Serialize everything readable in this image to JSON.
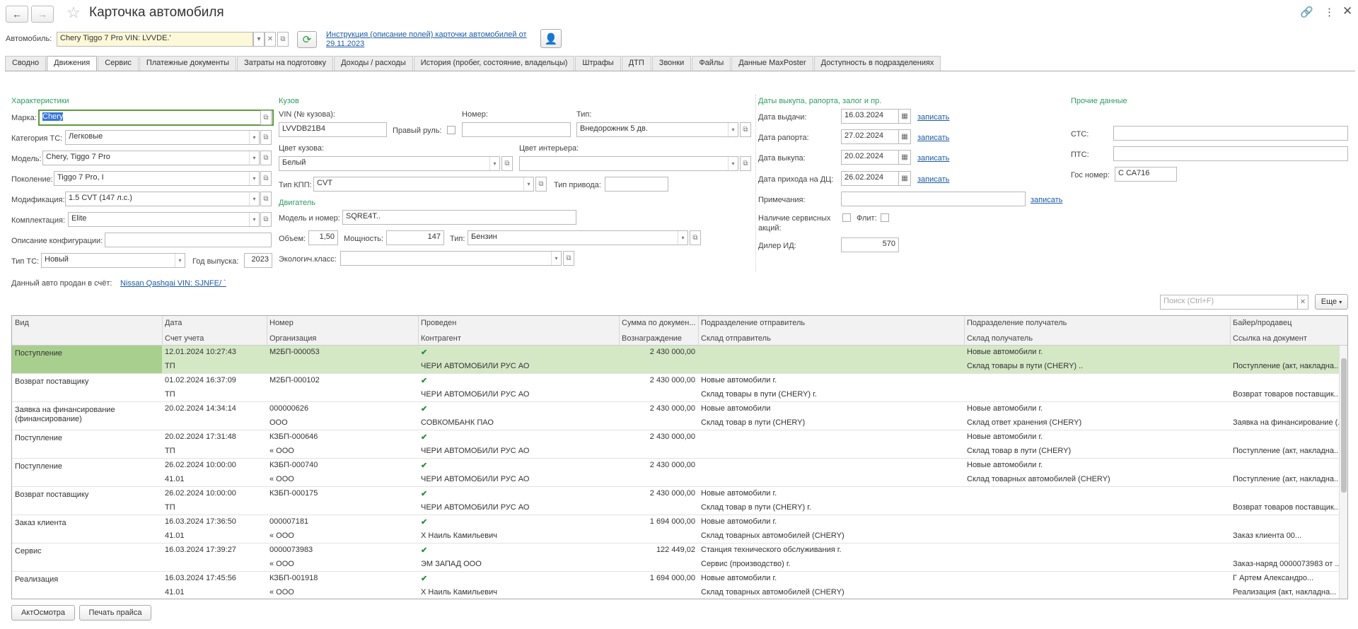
{
  "window": {
    "title": "Карточка автомобиля"
  },
  "header": {
    "car_label": "Автомобиль:",
    "car_value": "Chery Tiggo 7 Pro VIN: LVVDE.'",
    "instruction_link_line1": "Инструкция (описание полей) карточки автомобилей от",
    "instruction_link_line2": "29.11.2023"
  },
  "tabs": [
    "Сводно",
    "Движения",
    "Сервис",
    "Платежные документы",
    "Затраты на подготовку",
    "Доходы / расходы",
    "История (пробег, состояние, владельцы)",
    "Штрафы",
    "ДТП",
    "Звонки",
    "Файлы",
    "Данные MaxPoster",
    "Доступность в подразделениях"
  ],
  "characteristics": {
    "section": "Характеристики",
    "brand_label": "Марка:",
    "brand": "Chery",
    "category_label": "Категория ТС:",
    "category": "Легковые",
    "model_label": "Модель:",
    "model": "Chery, Tiggo 7 Pro",
    "generation_label": "Поколение:",
    "generation": "Tiggo 7 Pro, I",
    "modification_label": "Модификация:",
    "modification": "1.5 CVT (147 л.с.)",
    "equipment_label": "Комплектация:",
    "equipment": "Elite",
    "config_desc_label": "Описание конфигурации:",
    "config_desc": "",
    "vehicle_type_label": "Тип ТС:",
    "vehicle_type": "Новый",
    "year_label": "Год выпуска:",
    "year": "2023",
    "sold_label": "Данный авто продан в счёт:",
    "sold_link": "Nissan Qashqai VIN: SJNFE/ `"
  },
  "body": {
    "section": "Кузов",
    "vin_label": "VIN (№ кузова):",
    "vin": "LVVDB21B4",
    "right_wheel_label": "Правый руль:",
    "number_label": "Номер:",
    "number": "",
    "type_label": "Тип:",
    "type": "Внедорожник 5 дв.",
    "body_color_label": "Цвет кузова:",
    "body_color": "Белый",
    "interior_color_label": "Цвет интерьера:",
    "interior_color": "",
    "gearbox_label": "Тип КПП:",
    "gearbox": "CVT",
    "drive_label": "Тип привода:",
    "drive": ""
  },
  "engine": {
    "section": "Двигатель",
    "model_label": "Модель и номер:",
    "model": "SQRE4T..",
    "volume_label": "Объем:",
    "volume": "1,50",
    "power_label": "Мощность:",
    "power": "147",
    "type_label": "Тип:",
    "type": "Бензин",
    "eco_label": "Экологич.класс:",
    "eco": ""
  },
  "dates": {
    "section": "Даты выкупа, рапорта, залог и пр.",
    "issue_label": "Дата выдачи:",
    "issue": "16.03.2024",
    "report_label": "Дата рапорта:",
    "report": "27.02.2024",
    "buyout_label": "Дата выкупа:",
    "buyout": "20.02.2024",
    "arrival_label": "Дата прихода на ДЦ:",
    "arrival": "26.02.2024",
    "write_link": "записать",
    "notes_label": "Примечания:",
    "notes": "",
    "service_actions_label_1": "Наличие сервисных",
    "service_actions_label_2": "акций:",
    "fleet_label": "Флит:",
    "dealer_label": "Дилер ИД:",
    "dealer": "570"
  },
  "other": {
    "section": "Прочие данные",
    "sts_label": "СТС:",
    "sts": "",
    "pts_label": "ПТС:",
    "pts": "",
    "gos_label": "Гос номер:",
    "gos": "С    СА716"
  },
  "search": {
    "placeholder": "Поиск (Ctrl+F)",
    "more": "Еще"
  },
  "grid": {
    "headers_top": [
      "Вид",
      "Дата",
      "Номер",
      "Проведен",
      "Сумма по докумен...",
      "Подразделение отправитель",
      "Подразделение получатель",
      "Байер/продавец"
    ],
    "headers_bottom": [
      "Счет учета",
      "Организация",
      "Контрагент",
      "Вознаграждение",
      "Склад отправитель",
      "Склад получатель",
      "Ссылка на документ"
    ],
    "rows": [
      {
        "kind": "Поступление",
        "date": "12.01.2024 10:27:43",
        "account": "ТП",
        "number": "М2БП-000053",
        "org": "",
        "posted": "✔",
        "contractor": "ЧЕРИ АВТОМОБИЛИ РУС АО",
        "sum": "2 430 000,00",
        "reward": "",
        "sender": "",
        "sender_wh": "",
        "recipient": "Новые автомобили г.",
        "recipient_wh": "Склад товары в пути (CHERY) ..",
        "buyer": "",
        "doc": "Поступление (акт, накладна..."
      },
      {
        "kind": "Возврат поставщику",
        "date": "01.02.2024 16:37:09",
        "account": "ТП",
        "number": "М2БП-000102",
        "org": "",
        "posted": "✔",
        "contractor": "ЧЕРИ АВТОМОБИЛИ РУС АО",
        "sum": "2 430 000,00",
        "reward": "",
        "sender": "Новые автомобили г.",
        "sender_wh": "Склад товары в пути (CHERY) г.",
        "recipient": "",
        "recipient_wh": "",
        "buyer": "",
        "doc": "Возврат товаров поставщик..."
      },
      {
        "kind": "Заявка на финансирование (финансирование)",
        "date": "20.02.2024 14:34:14",
        "account": "",
        "number": "000000626",
        "org": "ООО",
        "posted": "✔",
        "contractor": "СОВКОМБАНК ПАО",
        "sum": "2 430 000,00",
        "reward": "",
        "sender": "Новые автомобили",
        "sender_wh": "Склад товар в пути (CHERY)",
        "recipient": "Новые автомобили г.",
        "recipient_wh": "Склад ответ хранения (CHERY)",
        "buyer": "",
        "doc": "Заявка на финансирование (..."
      },
      {
        "kind": "Поступление",
        "date": "20.02.2024 17:31:48",
        "account": "ТП",
        "number": "КЗБП-000646",
        "org": "« ООО",
        "posted": "✔",
        "contractor": "ЧЕРИ АВТОМОБИЛИ РУС АО",
        "sum": "2 430 000,00",
        "reward": "",
        "sender": "",
        "sender_wh": "",
        "recipient": "Новые автомобили г.",
        "recipient_wh": "Склад товар в пути (CHERY)",
        "buyer": "",
        "doc": "Поступление (акт, накладна..."
      },
      {
        "kind": "Поступление",
        "date": "26.02.2024 10:00:00",
        "account": "41.01",
        "number": "КЗБП-000740",
        "org": "« ООО",
        "posted": "✔",
        "contractor": "ЧЕРИ АВТОМОБИЛИ РУС АО",
        "sum": "2 430 000,00",
        "reward": "",
        "sender": "",
        "sender_wh": "",
        "recipient": "Новые автомобили г.",
        "recipient_wh": "Склад товарных автомобилей (CHERY)",
        "buyer": "",
        "doc": "Поступление (акт, накладна..."
      },
      {
        "kind": "Возврат поставщику",
        "date": "26.02.2024 10:00:00",
        "account": "ТП",
        "number": "КЗБП-000175",
        "org": "",
        "posted": "✔",
        "contractor": "ЧЕРИ АВТОМОБИЛИ РУС АО",
        "sum": "2 430 000,00",
        "reward": "",
        "sender": "Новые автомобили г.",
        "sender_wh": "Склад товар в пути (CHERY) г.",
        "recipient": "",
        "recipient_wh": "",
        "buyer": "",
        "doc": "Возврат товаров поставщик..."
      },
      {
        "kind": "Заказ клиента",
        "date": "16.03.2024 17:36:50",
        "account": "41.01",
        "number": "000007181",
        "org": "« ООО",
        "posted": "✔",
        "contractor": "Х      Наиль Камильевич",
        "sum": "1 694 000,00",
        "reward": "",
        "sender": "Новые автомобили г.",
        "sender_wh": "Склад товарных автомобилей (CHERY)",
        "recipient": "",
        "recipient_wh": "",
        "buyer": "",
        "doc": "Заказ клиента             00..."
      },
      {
        "kind": "Сервис",
        "date": "16.03.2024 17:39:27",
        "account": "",
        "number": "0000073983",
        "org": "« ООО",
        "posted": "✔",
        "contractor": "ЭМ ЗАПАД ООО",
        "sum": "122 449,02",
        "reward": "",
        "sender": "Станция технического обслуживания г.",
        "sender_wh": "Сервис (производство) г.",
        "recipient": "",
        "recipient_wh": "",
        "buyer": "",
        "doc": "Заказ-наряд 0000073983 от ..."
      },
      {
        "kind": "Реализация",
        "date": "16.03.2024 17:45:56",
        "account": "41.01",
        "number": "КЗБП-001918",
        "org": "« ООО",
        "posted": "✔",
        "contractor": "Х      Наиль Камильевич",
        "sum": "1 694 000,00",
        "reward": "",
        "sender": "Новые автомобили г.",
        "sender_wh": "Склад товарных автомобилей (CHERY)",
        "recipient": "",
        "recipient_wh": "",
        "buyer": "Г       Артем Александро...",
        "doc": "Реализация (акт, накладна..."
      }
    ]
  },
  "footer": {
    "inspection_button": "АктОсмотра",
    "price_button": "Печать прайса"
  }
}
